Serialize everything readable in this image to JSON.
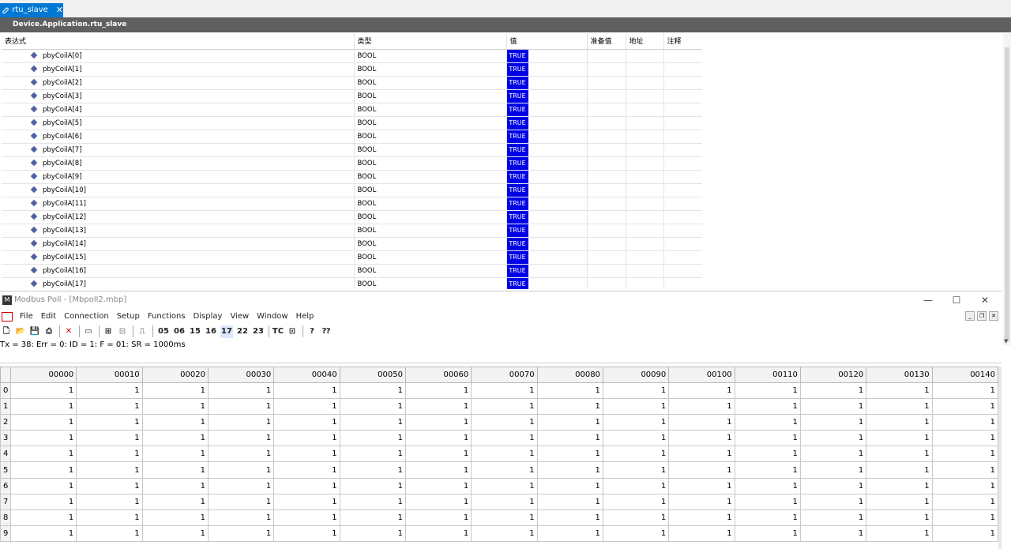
{
  "watch_window": {
    "tab_label": "rtu_slave",
    "path": "Device.Application.rtu_slave",
    "columns": [
      "表达式",
      "类型",
      "值",
      "准备值",
      "地址",
      "注释"
    ],
    "rows": [
      {
        "expr": "pbyCoilA[0]",
        "type": "BOOL",
        "value": "TRUE"
      },
      {
        "expr": "pbyCoilA[1]",
        "type": "BOOL",
        "value": "TRUE"
      },
      {
        "expr": "pbyCoilA[2]",
        "type": "BOOL",
        "value": "TRUE"
      },
      {
        "expr": "pbyCoilA[3]",
        "type": "BOOL",
        "value": "TRUE"
      },
      {
        "expr": "pbyCoilA[4]",
        "type": "BOOL",
        "value": "TRUE"
      },
      {
        "expr": "pbyCoilA[5]",
        "type": "BOOL",
        "value": "TRUE"
      },
      {
        "expr": "pbyCoilA[6]",
        "type": "BOOL",
        "value": "TRUE"
      },
      {
        "expr": "pbyCoilA[7]",
        "type": "BOOL",
        "value": "TRUE"
      },
      {
        "expr": "pbyCoilA[8]",
        "type": "BOOL",
        "value": "TRUE"
      },
      {
        "expr": "pbyCoilA[9]",
        "type": "BOOL",
        "value": "TRUE"
      },
      {
        "expr": "pbyCoilA[10]",
        "type": "BOOL",
        "value": "TRUE"
      },
      {
        "expr": "pbyCoilA[11]",
        "type": "BOOL",
        "value": "TRUE"
      },
      {
        "expr": "pbyCoilA[12]",
        "type": "BOOL",
        "value": "TRUE"
      },
      {
        "expr": "pbyCoilA[13]",
        "type": "BOOL",
        "value": "TRUE"
      },
      {
        "expr": "pbyCoilA[14]",
        "type": "BOOL",
        "value": "TRUE"
      },
      {
        "expr": "pbyCoilA[15]",
        "type": "BOOL",
        "value": "TRUE"
      },
      {
        "expr": "pbyCoilA[16]",
        "type": "BOOL",
        "value": "TRUE"
      },
      {
        "expr": "pbyCoilA[17]",
        "type": "BOOL",
        "value": "TRUE"
      }
    ],
    "value_color": "#0000e6"
  },
  "modbus_poll": {
    "title": "Modbus Poll - [Mbpoll2.mbp]",
    "menu": [
      "File",
      "Edit",
      "Connection",
      "Setup",
      "Functions",
      "Display",
      "View",
      "Window",
      "Help"
    ],
    "toolbar_function_codes": [
      "05",
      "06",
      "15",
      "16",
      "17",
      "22",
      "23"
    ],
    "toolbar_tc": "TC",
    "status": "Tx = 38: Err = 0: ID = 1: F = 01: SR = 1000ms",
    "grid_columns": [
      "00000",
      "00010",
      "00020",
      "00030",
      "00040",
      "00050",
      "00060",
      "00070",
      "00080",
      "00090",
      "00100",
      "00110",
      "00120",
      "00130",
      "00140"
    ],
    "grid_row_labels": [
      "0",
      "1",
      "2",
      "3",
      "4",
      "5",
      "6",
      "7",
      "8",
      "9"
    ],
    "cell_value": "1"
  }
}
